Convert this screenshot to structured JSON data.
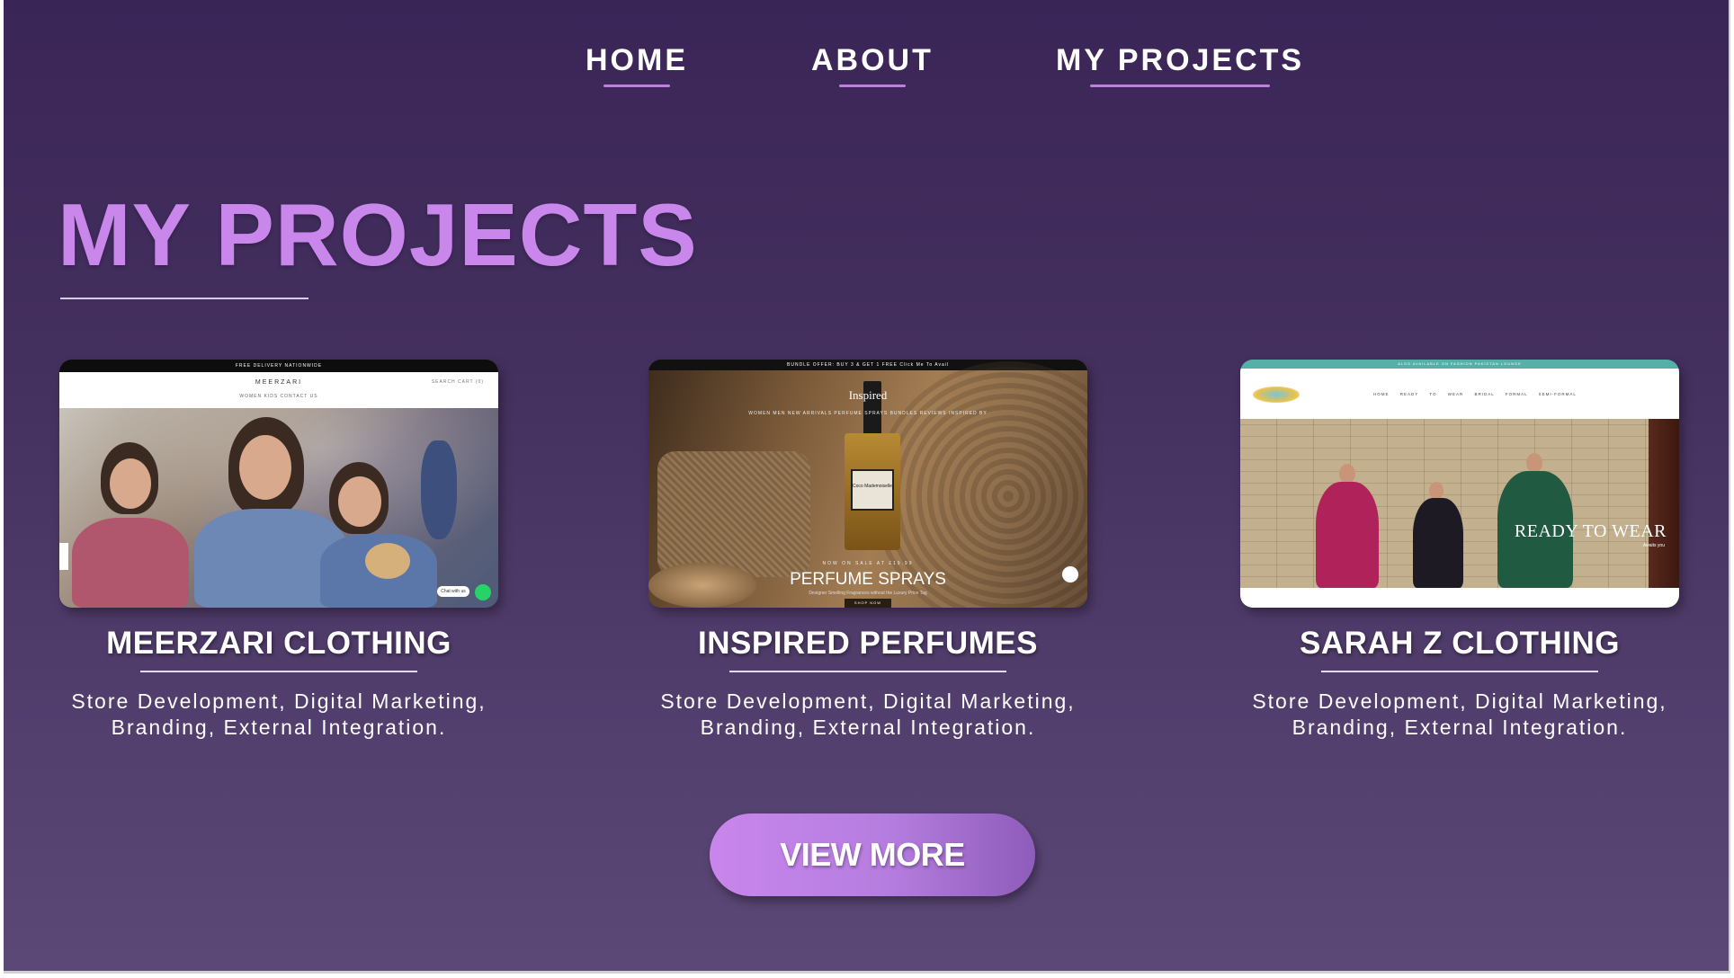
{
  "nav": {
    "items": [
      {
        "label": "HOME"
      },
      {
        "label": "ABOUT"
      },
      {
        "label": "MY PROJECTS"
      }
    ],
    "underline_color": "#c07ee0"
  },
  "page": {
    "title": "MY PROJECTS",
    "title_color": "#c987ec",
    "background_top": "#3a2557",
    "background_bottom": "#5b4876"
  },
  "projects": [
    {
      "name": "MEERZARI CLOTHING",
      "description_line1": "Store Development, Digital Marketing,",
      "description_line2": "Branding, External Integration.",
      "screenshot": {
        "top_bar": "FREE DELIVERY NATIONWIDE",
        "brand": "MEERZARI",
        "menu": "WOMEN    KIDS    CONTACT US",
        "cart": "SEARCH    CART (0)",
        "chat": "Chat with us"
      }
    },
    {
      "name": "INSPIRED PERFUMES",
      "description_line1": "Store Development, Digital Marketing,",
      "description_line2": "Branding, External Integration.",
      "screenshot": {
        "top_bar": "BUNDLE OFFER: BUY 3 & GET 1 FREE Click Me To Avail",
        "brand": "Inspired",
        "menu": "WOMEN   MEN   NEW ARRIVALS   PERFUME SPRAYS   BUNDLES   REVIEWS   INSPIRED BY",
        "sale": "NOW ON SALE AT £19.99",
        "headline": "PERFUME SPRAYS",
        "tagline": "Designer Smelling Fragrances without the Luxury Price Tag",
        "button": "SHOP NOW",
        "bottle_label": "Coco Mademoiselle"
      }
    },
    {
      "name": "SARAH Z CLOTHING",
      "description_line1": "Store Development, Digital Marketing,",
      "description_line2": "Branding, External Integration.",
      "screenshot": {
        "top_bar": "ALSO AVAILABLE ON FASHION PAKISTAN LOUNGE",
        "menu": "HOME READY TO WEAR BRIDAL FORMAL SEMI-FORMAL",
        "headline": "READY TO WEAR",
        "sub": "Awaits you"
      }
    }
  ],
  "cta": {
    "label": "VIEW MORE"
  }
}
